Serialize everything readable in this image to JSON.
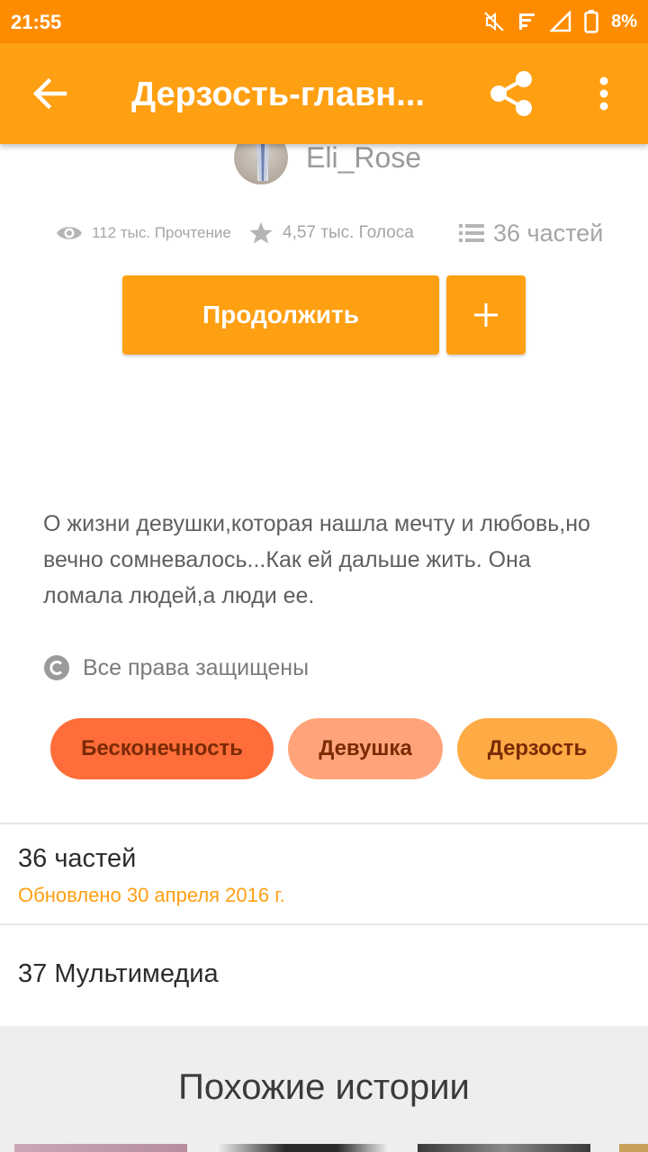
{
  "status_bar": {
    "time": "21:55",
    "battery": "8%"
  },
  "app_bar": {
    "title": "Дерзость-главн...",
    "icons": [
      "back-arrow-icon",
      "share-icon",
      "more-vert-icon"
    ]
  },
  "author": {
    "name": "Eli_Rose"
  },
  "stats": {
    "reads": "112 тыс. Прочтение",
    "votes": "4,57 тыс. Голоса",
    "parts": "36 частей"
  },
  "actions": {
    "continue_label": "Продолжить",
    "add_icon": "plus-icon"
  },
  "description": "О жизни девушки,которая нашла мечту и любовь,но вечно сомневалось...Как ей дальше жить. Она ломала людей,а люди ее.",
  "copyright": "Все права защищены",
  "tags": [
    {
      "label": "Бесконечность",
      "color": "#ff6d3a"
    },
    {
      "label": "Девушка",
      "color": "#ffa47a"
    },
    {
      "label": "Дерзость",
      "color": "#ffab45"
    }
  ],
  "parts_section": {
    "title": "36 частей",
    "updated": "Обновлено 30 апреля 2016 г."
  },
  "media_section": {
    "title": "37 Мультимедиа"
  },
  "similar": {
    "title": "Похожие истории"
  },
  "colors": {
    "status_bar": "#ff8c00",
    "app_bar": "#ff9f12",
    "accent": "#ff9f12"
  }
}
